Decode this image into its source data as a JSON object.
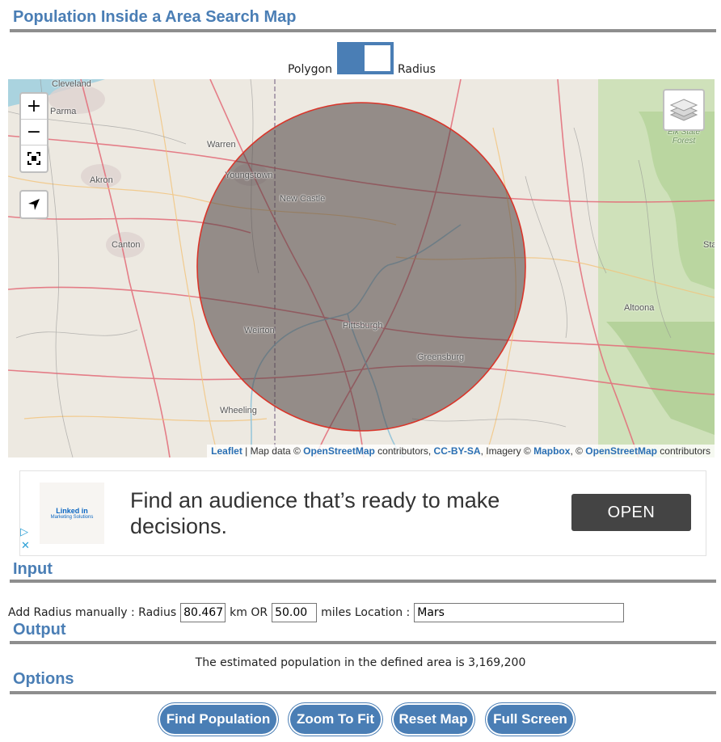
{
  "page_title": "Population Inside a Area Search Map",
  "toggle": {
    "left_label": "Polygon",
    "right_label": "Radius",
    "selected": "Radius"
  },
  "map": {
    "controls": {
      "zoom_in": "+",
      "zoom_out": "−",
      "fit_icon": "fit-bounds-icon",
      "locate_icon": "locate-arrow-icon",
      "layers_icon": "layers-icon"
    },
    "cities": {
      "cleveland": "Cleveland",
      "parma": "Parma",
      "warren": "Warren",
      "youngstown": "Youngstown",
      "akron": "Akron",
      "new_castle": "New Castle",
      "canton": "Canton",
      "weirton": "Weirton",
      "pittsburgh": "Pittsburgh",
      "greensburg": "Greensburg",
      "altoona": "Altoona",
      "wheeling": "Wheeling",
      "forest": "Elk State\nForest",
      "sta": "Sta"
    },
    "attribution": {
      "leaflet": "Leaflet",
      "sep1": " | Map data © ",
      "osm1": "OpenStreetMap",
      "contrib1": " contributors, ",
      "ccbysa": "CC-BY-SA",
      "imagery": ", Imagery © ",
      "mapbox": "Mapbox",
      "comma": ", © ",
      "osm2": "OpenStreetMap",
      "contrib2": " contributors"
    },
    "colors": {
      "circle_fill": "#4a4040",
      "circle_stroke": "#d9352a"
    }
  },
  "ad": {
    "logo_main": "Linked in",
    "logo_sub": "Marketing Solutions",
    "headline": "Find an audience that’s ready to make decisions.",
    "cta": "OPEN",
    "play_icon": "▷",
    "close_icon": "✕"
  },
  "input_section": {
    "title": "Input",
    "label_prefix": "Add Radius manually : Radius",
    "radius_km": "80.467",
    "km_label": "km OR",
    "radius_miles": "50.00",
    "miles_label": "miles Location :",
    "location": "Mars"
  },
  "output_section": {
    "title": "Output",
    "text": "The estimated population in the defined area is 3,169,200"
  },
  "options_section": {
    "title": "Options",
    "buttons": {
      "find_population": "Find Population",
      "zoom_to_fit": "Zoom To Fit",
      "reset_map": "Reset Map",
      "full_screen": "Full Screen"
    }
  },
  "accent_color": "#4a7eb5"
}
